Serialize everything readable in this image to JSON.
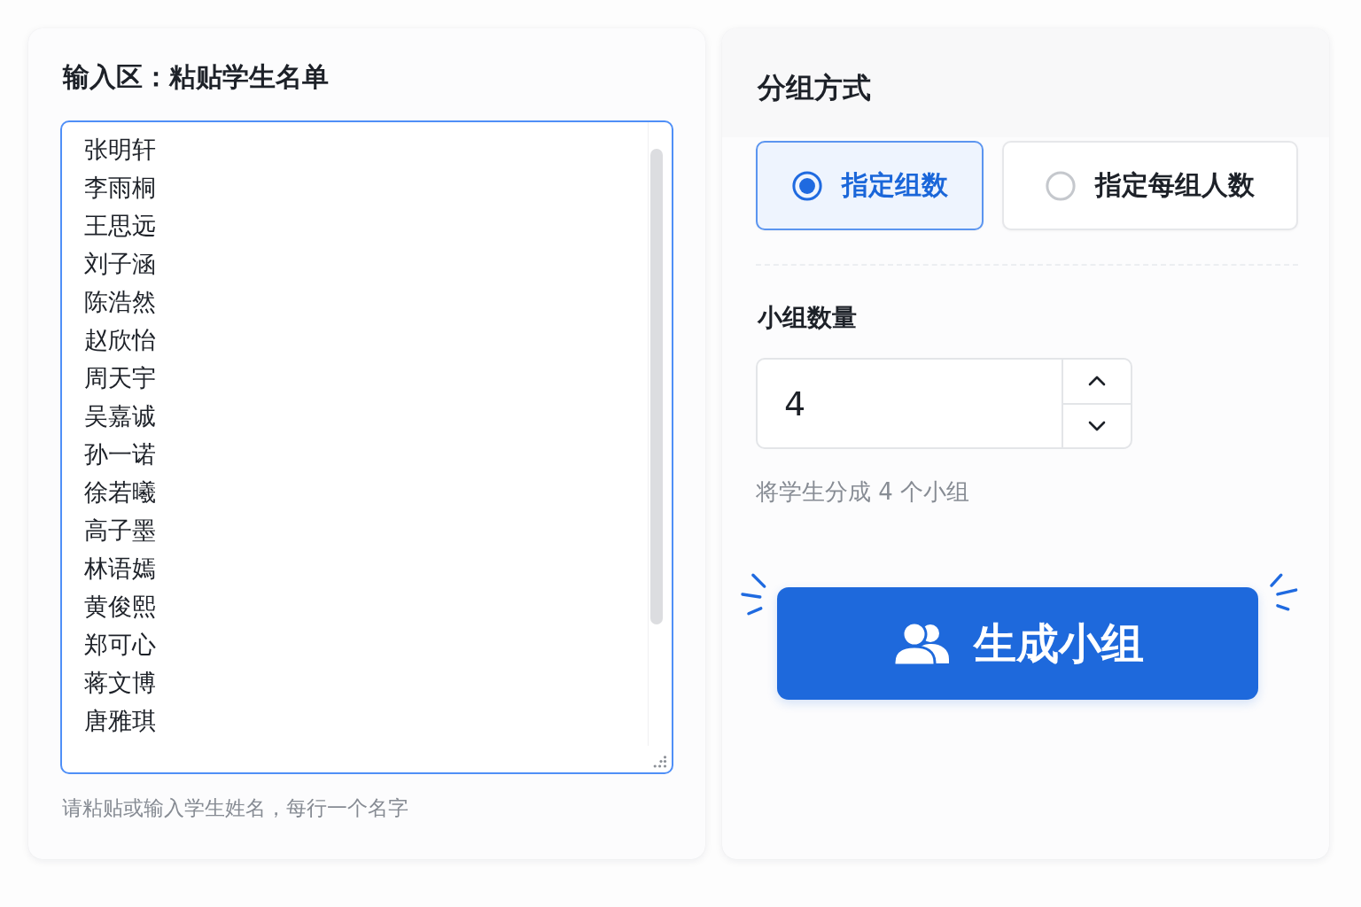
{
  "input_panel": {
    "title": "输入区：粘贴学生名单",
    "names": [
      "张明轩",
      "李雨桐",
      "王思远",
      "刘子涵",
      "陈浩然",
      "赵欣怡",
      "周天宇",
      "吴嘉诚",
      "孙一诺",
      "徐若曦",
      "高子墨",
      "林语嫣",
      "黄俊熙",
      "郑可心",
      "蒋文博",
      "唐雅琪"
    ],
    "hint": "请粘贴或输入学生姓名，每行一个名字"
  },
  "grouping_panel": {
    "title": "分组方式",
    "modes": [
      {
        "label": "指定组数",
        "selected": true
      },
      {
        "label": "指定每组人数",
        "selected": false
      }
    ],
    "count_label": "小组数量",
    "count_value": "4",
    "summary": "将学生分成 4 个小组",
    "generate_button": "生成小组"
  }
}
